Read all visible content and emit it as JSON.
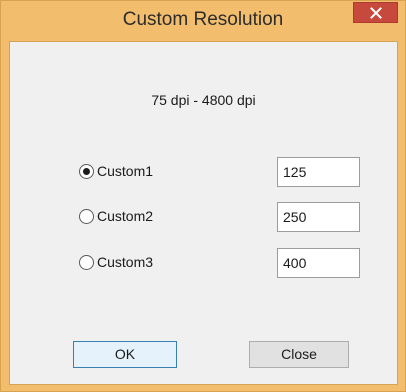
{
  "window": {
    "title": "Custom Resolution",
    "close_icon": "close-icon"
  },
  "range_text": "75 dpi - 4800 dpi",
  "options": [
    {
      "label": "Custom1",
      "value": "125",
      "selected": true
    },
    {
      "label": "Custom2",
      "value": "250",
      "selected": false
    },
    {
      "label": "Custom3",
      "value": "400",
      "selected": false
    }
  ],
  "buttons": {
    "ok": "OK",
    "close": "Close"
  },
  "colors": {
    "titlebar": "#f2be6e",
    "close_button": "#c7483c",
    "client_background": "#f0f0f0",
    "default_button_border": "#3c7fb1"
  }
}
